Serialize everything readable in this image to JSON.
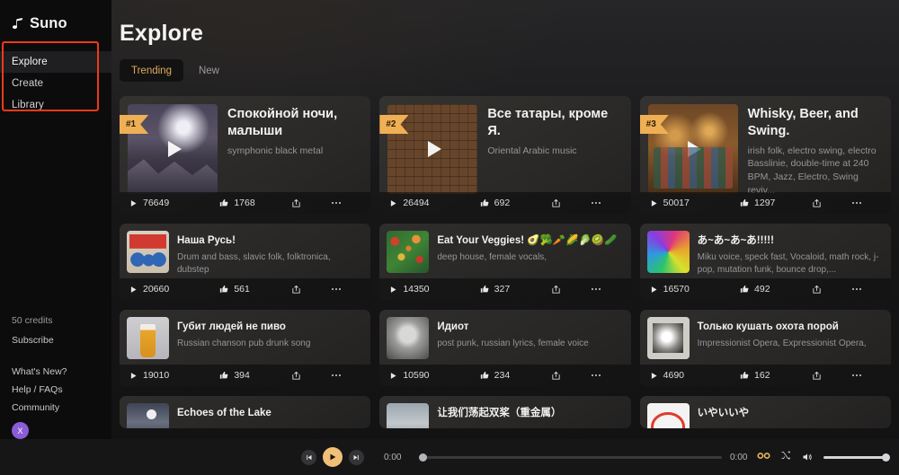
{
  "sidebar": {
    "logo": {
      "text": "Suno",
      "icon": "suno-note-icon"
    },
    "nav": [
      {
        "label": "Explore",
        "active": true
      },
      {
        "label": "Create",
        "active": false
      },
      {
        "label": "Library",
        "active": false
      }
    ],
    "credits": "50 credits",
    "subscribe": "Subscribe",
    "links": [
      "What's New?",
      "Help / FAQs",
      "Community"
    ],
    "avatar_initial": "X",
    "avatar_color": "#8a5cd6",
    "highlight_color": "#ef3a18"
  },
  "header": {
    "title": "Explore",
    "tabs": [
      {
        "label": "Trending",
        "active": true
      },
      {
        "label": "New",
        "active": false
      }
    ],
    "active_tab_color": "#e0ab5e"
  },
  "cards": [
    {
      "rank": "#1",
      "title": "Спокойной ночи, малыши",
      "tags": "symphonic black metal",
      "plays": "76649",
      "likes": "1768",
      "art": "t-night",
      "size": "big"
    },
    {
      "rank": "#2",
      "title": "Все татары, кроме Я.",
      "tags": "Oriental Arabic music",
      "plays": "26494",
      "likes": "692",
      "art": "t-tatar",
      "size": "big"
    },
    {
      "rank": "#3",
      "title": "Whisky, Beer, and Swing.",
      "tags": "irish folk, electro swing, electro Basslinie, double-time at 240 BPM, Jazz, Electro, Swing reviv...",
      "plays": "50017",
      "likes": "1297",
      "art": "t-pub",
      "size": "big"
    },
    {
      "rank": "",
      "title": "Наша Русь!",
      "tags": "Drum and bass, slavic folk, folktronica, dubstep",
      "plays": "20660",
      "likes": "561",
      "art": "t-rus",
      "size": "small"
    },
    {
      "rank": "",
      "title": "Eat Your Veggies! 🥑🥦🥕🌽🥬🥝🥒",
      "tags": "deep house, female vocals,",
      "plays": "14350",
      "likes": "327",
      "art": "t-veg",
      "size": "small"
    },
    {
      "rank": "",
      "title": "あ~あ~あ~あ!!!!!",
      "tags": "Miku voice, speck fast, Vocaloid, math rock, j-pop, mutation funk, bounce drop,...",
      "plays": "16570",
      "likes": "492",
      "art": "t-rainbow",
      "size": "small"
    },
    {
      "rank": "",
      "title": "Губит людей не пиво",
      "tags": "Russian chanson pub drunk song",
      "plays": "19010",
      "likes": "394",
      "art": "t-beer",
      "size": "small"
    },
    {
      "rank": "",
      "title": "Идиот",
      "tags": "post punk, russian lyrics, female voice",
      "plays": "10590",
      "likes": "234",
      "art": "t-idiot",
      "size": "small"
    },
    {
      "rank": "",
      "title": "Только кушать охота порой",
      "tags": "Impressionist Opera, Expressionist Opera,",
      "plays": "4690",
      "likes": "162",
      "art": "t-opera",
      "size": "small"
    },
    {
      "rank": "",
      "title": "Echoes of the Lake",
      "tags": "",
      "plays": "",
      "likes": "",
      "art": "t-lake",
      "size": "cut"
    },
    {
      "rank": "",
      "title": "让我们荡起双桨（重金属）",
      "tags": "",
      "plays": "",
      "likes": "",
      "art": "t-boat",
      "size": "cut"
    },
    {
      "rank": "",
      "title": "いやいいや",
      "tags": "",
      "plays": "",
      "likes": "",
      "art": "t-iyaiya",
      "size": "cut"
    }
  ],
  "player": {
    "prev_icon": "skip-back-icon",
    "play_icon": "play-icon",
    "next_icon": "skip-forward-icon",
    "time_current": "0:00",
    "time_total": "0:00",
    "loop_icon": "loop-infinite-icon",
    "shuffle_icon": "shuffle-icon",
    "volume_icon": "volume-icon",
    "loop_color": "#e8b45c",
    "progress_percent": 0,
    "volume_percent": 100
  }
}
